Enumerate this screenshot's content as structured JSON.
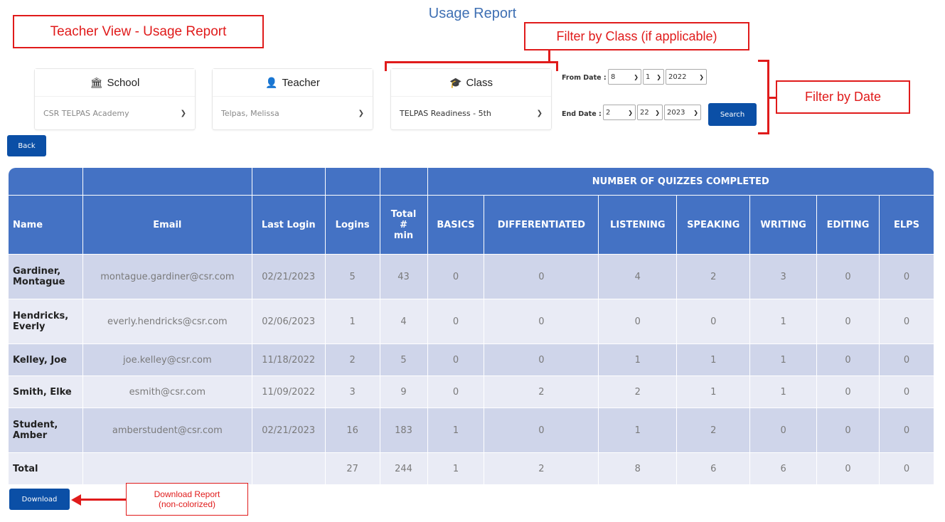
{
  "page_title": "Usage Report",
  "annotations": {
    "teacher_view": "Teacher View - Usage Report",
    "filter_class": "Filter by Class (if applicable)",
    "filter_date": "Filter by Date",
    "download_report": "Download Report\n(non-colorized)"
  },
  "filters": {
    "school": {
      "label": "School",
      "icon": "institution-icon",
      "value": "CSR TELPAS Academy"
    },
    "teacher": {
      "label": "Teacher",
      "icon": "user-icon",
      "value": "Telpas, Melissa"
    },
    "class": {
      "label": "Class",
      "icon": "graduation-cap-icon",
      "value": "TELPAS Readiness - 5th"
    }
  },
  "dates": {
    "from_label": "From Date :",
    "from": {
      "month": "8",
      "day": "1",
      "year": "2022"
    },
    "end_label": "End Date :",
    "end": {
      "month": "2",
      "day": "22",
      "year": "2023"
    }
  },
  "buttons": {
    "search": "Search",
    "back": "Back",
    "download": "Download"
  },
  "table": {
    "group_header": "NUMBER OF QUIZZES COMPLETED",
    "columns": [
      "Name",
      "Email",
      "Last Login",
      "Logins",
      "Total\n#\nmin",
      "BASICS",
      "DIFFERENTIATED",
      "LISTENING",
      "SPEAKING",
      "WRITING",
      "EDITING",
      "ELPS"
    ],
    "rows": [
      [
        "Gardiner, Montague",
        "montague.gardiner@csr.com",
        "02/21/2023",
        "5",
        "43",
        "0",
        "0",
        "4",
        "2",
        "3",
        "0",
        "0"
      ],
      [
        "Hendricks, Everly",
        "everly.hendricks@csr.com",
        "02/06/2023",
        "1",
        "4",
        "0",
        "0",
        "0",
        "0",
        "1",
        "0",
        "0"
      ],
      [
        "Kelley, Joe",
        "joe.kelley@csr.com",
        "11/18/2022",
        "2",
        "5",
        "0",
        "0",
        "1",
        "1",
        "1",
        "0",
        "0"
      ],
      [
        "Smith, Elke",
        "esmith@csr.com",
        "11/09/2022",
        "3",
        "9",
        "0",
        "2",
        "2",
        "1",
        "1",
        "0",
        "0"
      ],
      [
        "Student, Amber",
        "amberstudent@csr.com",
        "02/21/2023",
        "16",
        "183",
        "1",
        "0",
        "1",
        "2",
        "0",
        "0",
        "0"
      ]
    ],
    "total": [
      "Total",
      "",
      "",
      "27",
      "244",
      "1",
      "2",
      "8",
      "6",
      "6",
      "0",
      "0"
    ]
  },
  "colors": {
    "header_bg": "#4472c4",
    "row_odd": "#cfd5ea",
    "row_even": "#e9ebf5",
    "button": "#0b4fa6",
    "annotation": "#e01b1b"
  }
}
